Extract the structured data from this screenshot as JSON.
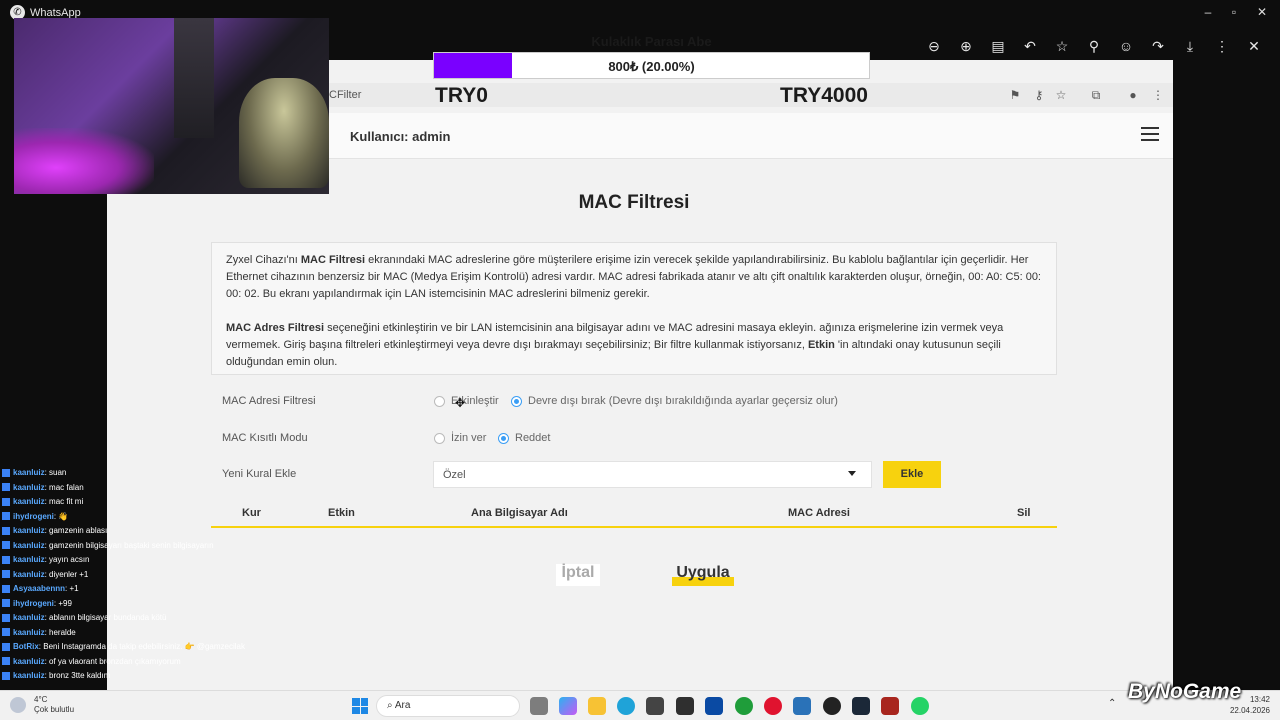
{
  "window": {
    "app_name": "WhatsApp"
  },
  "viewer_toolbar": {
    "icons": [
      "zoom-out-icon",
      "zoom-in-icon",
      "caption-icon",
      "reply-icon",
      "star-icon",
      "pin-icon",
      "emoji-icon",
      "forward-icon",
      "download-icon",
      "more-icon",
      "close-icon"
    ]
  },
  "browser": {
    "url_fragment": "CFilter"
  },
  "app": {
    "user_label": "Kullanıcı: admin",
    "page_title": "MAC Filtresi",
    "info": {
      "p1_pre": "Zyxel Cihazı'nı ",
      "p1_bold": "MAC Filtresi",
      "p1_post": " ekranındaki MAC adreslerine göre müşterilere erişime izin verecek şekilde yapılandırabilirsiniz. Bu kablolu bağlantılar için geçerlidir. Her Ethernet cihazının benzersiz bir MAC (Medya Erişim Kontrolü) adresi vardır. MAC adresi fabrikada atanır ve altı çift onaltılık karakterden oluşur, örneğin, 00: A0: C5: 00: 00: 02. Bu ekranı yapılandırmak için LAN istemcisinin MAC adreslerini bilmeniz gerekir.",
      "p2_bold": "MAC Adres Filtresi",
      "p2_mid": " seçeneğini etkinleştirin ve bir LAN istemcisinin ana bilgisayar adını ve MAC adresini masaya ekleyin. ağınıza erişmelerine izin vermek veya vermemek. Giriş başına filtreleri etkinleştirmeyi veya devre dışı bırakmayı seçebilirsiniz; Bir filtre kullanmak istiyorsanız, ",
      "p2_bold2": "Etkin",
      "p2_post": " 'in altındaki onay kutusunun seçili olduğundan emin olun."
    },
    "filter_row": {
      "label": "MAC Adresi Filtresi",
      "opt1": "Etkinleştir",
      "opt2": "Devre dışı bırak (Devre dışı bırakıldığında ayarlar geçersiz olur)",
      "selected": "opt2"
    },
    "mode_row": {
      "label": "MAC Kısıtlı Modu",
      "opt1": "İzin ver",
      "opt2": "Reddet",
      "selected": "opt2"
    },
    "add_row": {
      "label": "Yeni Kural Ekle",
      "select_value": "Özel",
      "button": "Ekle"
    },
    "table_headers": [
      "Kur",
      "Etkin",
      "Ana Bilgisayar Adı",
      "MAC Adresi",
      "Sil"
    ],
    "cancel": "İptal",
    "apply": "Uygula"
  },
  "donation": {
    "title": "Kulaklık Parası Abe",
    "text": "800₺ (20.00%)",
    "progress": 0.2,
    "goal_min": "TRY0",
    "goal_max": "TRY4000",
    "color": "#7a00ff"
  },
  "chat": [
    {
      "user": "kaanluiz",
      "msg": ": suan"
    },
    {
      "user": "kaanluiz",
      "msg": ": mac falan"
    },
    {
      "user": "kaanluiz",
      "msg": ": mac fit mi"
    },
    {
      "user": "ihydrogeni",
      "msg": ": 👋"
    },
    {
      "user": "kaanluiz",
      "msg": ": gamzenin ablası"
    },
    {
      "user": "kaanluiz",
      "msg": ": gamzenin bilgisayarı baştaki senin bilgisayarın"
    },
    {
      "user": "kaanluiz",
      "msg": ": yayın acsın"
    },
    {
      "user": "kaanluiz",
      "msg": ": diyenler +1"
    },
    {
      "user": "Asyaaabennn",
      "msg": ": +1"
    },
    {
      "user": "ihydrogeni",
      "msg": ": +99"
    },
    {
      "user": "kaanluiz",
      "msg": ": ablanın bilgisayar bundanda kötü"
    },
    {
      "user": "kaanluiz",
      "msg": ": heralde"
    },
    {
      "user": "BotRix",
      "msg": ": Beni Instagramda da takip edebilirsiniz. 👉 @gamzecilak"
    },
    {
      "user": "kaanluiz",
      "msg": ": of ya vlaorant bronzdan çıkamıyorum"
    },
    {
      "user": "kaanluiz",
      "msg": ": bronz 3tte kaldım"
    }
  ],
  "taskbar": {
    "temp": "4°C",
    "weather": "Çok bulutlu",
    "search": "Ara",
    "time": "13:42",
    "date": "22.04.2026",
    "start_color": "#1e88e5"
  },
  "watermark": "ByNoGame"
}
